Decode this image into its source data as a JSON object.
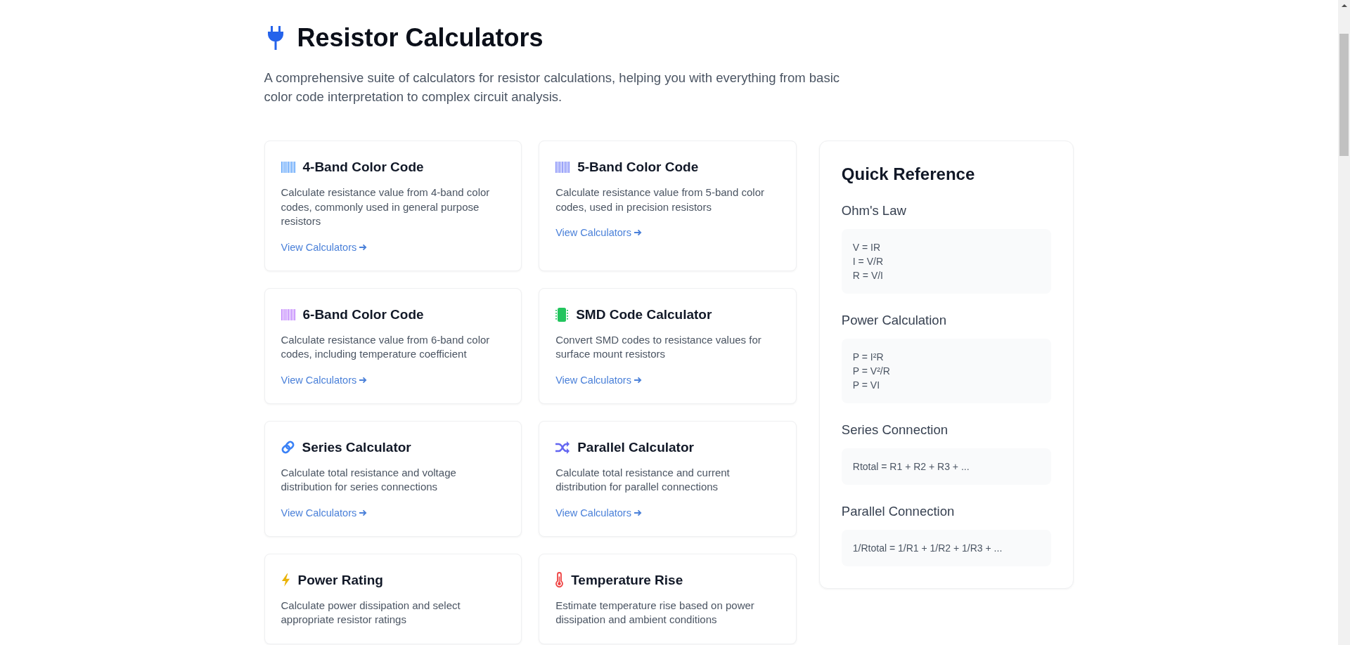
{
  "header": {
    "title": "Resistor Calculators",
    "description": "A comprehensive suite of calculators for resistor calculations, helping you with everything from basic color code interpretation to complex circuit analysis."
  },
  "cards": [
    {
      "kind": "colorcode",
      "color": "#60a5fa",
      "title": "4-Band Color Code",
      "description": "Calculate resistance value from 4-band color codes, commonly used in general purpose resistors",
      "link": "View Calculators"
    },
    {
      "kind": "colorcode",
      "color": "#818cf8",
      "title": "5-Band Color Code",
      "description": "Calculate resistance value from 5-band color codes, used in precision resistors",
      "link": "View Calculators"
    },
    {
      "kind": "colorcode",
      "color": "#c084fc",
      "title": "6-Band Color Code",
      "description": "Calculate resistance value from 6-band color codes, including temperature coefficient",
      "link": "View Calculators"
    },
    {
      "kind": "smd",
      "color": "#22c55e",
      "title": "SMD Code Calculator",
      "description": "Convert SMD codes to resistance values for surface mount resistors",
      "link": "View Calculators"
    },
    {
      "kind": "series",
      "color": "#3b82f6",
      "title": "Series Calculator",
      "description": "Calculate total resistance and voltage distribution for series connections",
      "link": "View Calculators"
    },
    {
      "kind": "parallel",
      "color": "#6366f1",
      "title": "Parallel Calculator",
      "description": "Calculate total resistance and current distribution for parallel connections",
      "link": "View Calculators"
    },
    {
      "kind": "power",
      "color": "#eab308",
      "title": "Power Rating",
      "description": "Calculate power dissipation and select appropriate resistor ratings"
    },
    {
      "kind": "thermal",
      "color": "#ef4444",
      "title": "Temperature Rise",
      "description": "Estimate temperature rise based on power dissipation and ambient conditions"
    }
  ],
  "quick_reference": {
    "title": "Quick Reference",
    "sections": [
      {
        "heading": "Ohm's Law",
        "formulas": [
          "V = IR",
          "I = V/R",
          "R = V/I"
        ]
      },
      {
        "heading": "Power Calculation",
        "formulas": [
          "P = I²R",
          "P = V²/R",
          "P = VI"
        ]
      },
      {
        "heading": "Series Connection",
        "formulas": [
          "Rtotal = R1 + R2 + R3 + ..."
        ]
      },
      {
        "heading": "Parallel Connection",
        "formulas": [
          "1/Rtotal = 1/R1 + 1/R2 + 1/R3 + ..."
        ]
      }
    ]
  }
}
